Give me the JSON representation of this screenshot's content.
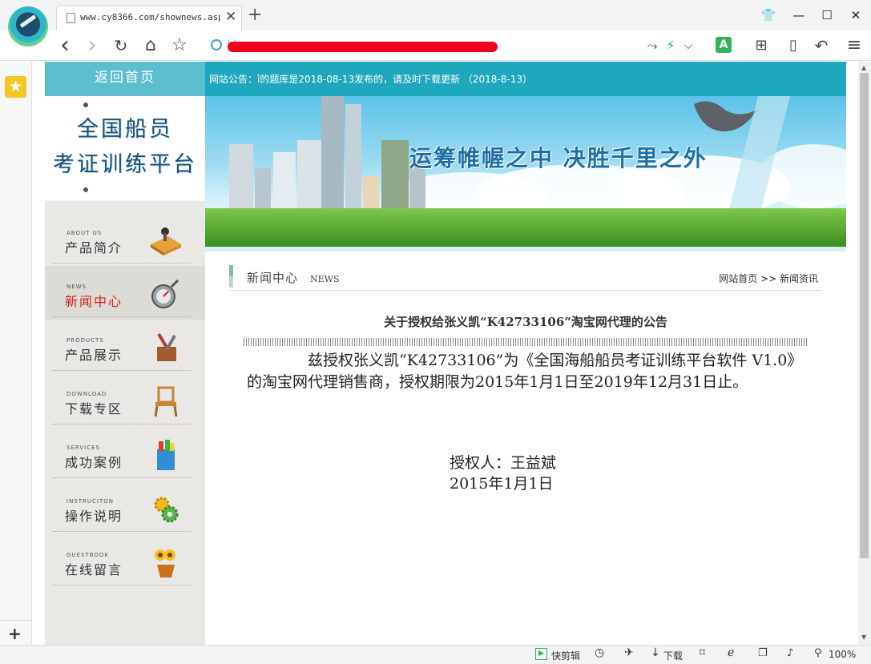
{
  "browser": {
    "tab_title": "www.cy8366.com/shownews.asp?i",
    "tab_close": "✕",
    "new_tab": "+",
    "address_text": "ht",
    "window_controls": {
      "skin": "👕",
      "minimize": "—",
      "maximize": "☐",
      "close": "✕"
    },
    "nav": {
      "back": "‹",
      "forward": "›",
      "reload": "↻",
      "home": "⌂",
      "favorite": "☆"
    },
    "right_tools": {
      "share": "⤳",
      "speed": "⚡",
      "dropdown": "⌵",
      "translate": "A",
      "apps": "⊞",
      "reading": "▯",
      "undo": "↶",
      "menu": "≡"
    },
    "sidebar": {
      "favorite_star": "★",
      "add": "+"
    },
    "status": {
      "quick_cut": "快剪辑",
      "download": "下载",
      "zoom": "100%"
    }
  },
  "site": {
    "home_button": "返回首页",
    "notice": "网站公告：î的题库是2018-08-13发布的，请及时下载更新 （2018-8-13）",
    "brand_line1": "全国船员",
    "brand_line2": "考证训练平台",
    "banner_slogan": "运筹帷幄之中 决胜千里之外",
    "menu": [
      {
        "en": "ABOUT US",
        "cn": "产品简介",
        "icon": "book-icon"
      },
      {
        "en": "NEWS",
        "cn": "新闻中心",
        "icon": "compass-icon"
      },
      {
        "en": "PRODUCTS",
        "cn": "产品展示",
        "icon": "tools-icon"
      },
      {
        "en": "DOWNLOAD",
        "cn": "下载专区",
        "icon": "chair-icon"
      },
      {
        "en": "SERVICES",
        "cn": "成功案例",
        "icon": "case-icon"
      },
      {
        "en": "INSTRUCITON",
        "cn": "操作说明",
        "icon": "gear-icon"
      },
      {
        "en": "GUESTBOOK",
        "cn": "在线留言",
        "icon": "flower-icon"
      }
    ],
    "content_header": {
      "title": "新闻中心",
      "en": "NEWS",
      "breadcrumb": "网站首页 >> 新闻资讯"
    },
    "article": {
      "title": "关于授权给张义凯“K42733106”淘宝网代理的公告",
      "body": "兹授权张义凯“K42733106”为《全国海船船员考证训练平台软件 V1.0》的淘宝网代理销售商，授权期限为2015年1月1日至2019年12月31日止。",
      "signer": "授权人：王益斌",
      "date": "2015年1月1日"
    }
  },
  "colors": {
    "band": "#1fa7be",
    "home_button": "#5dbfcd",
    "brand": "#13527f",
    "active_menu": "#d61f1f"
  }
}
